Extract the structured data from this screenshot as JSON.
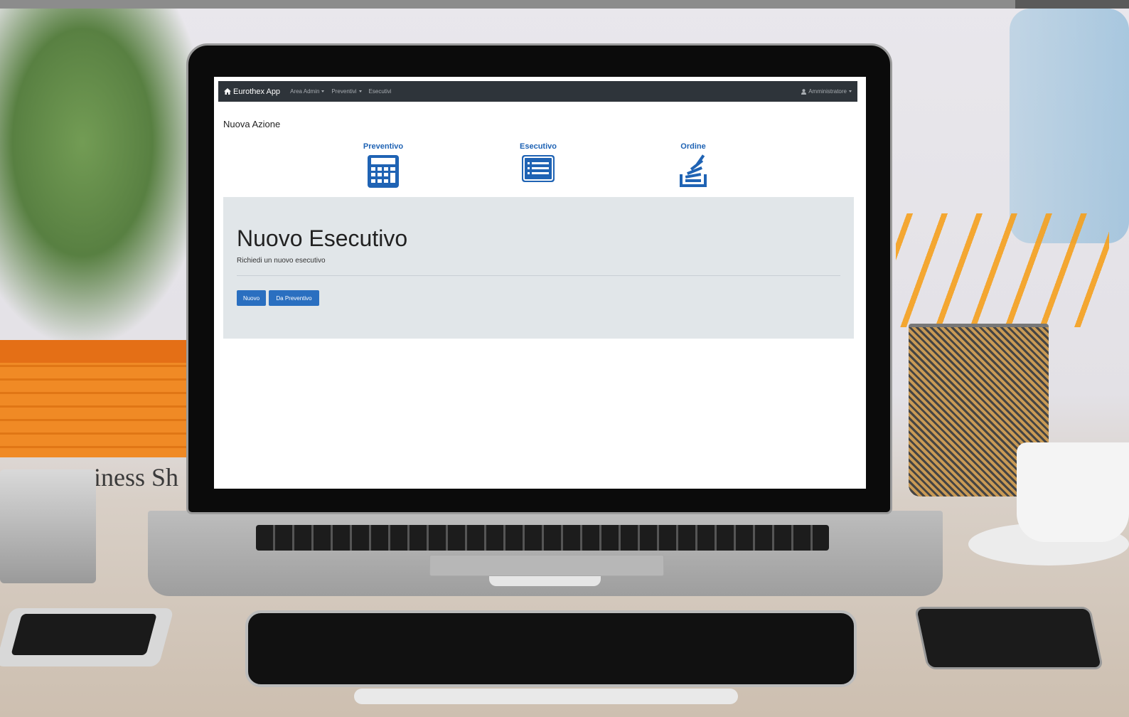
{
  "navbar": {
    "brand": "Eurothex App",
    "home_icon": "home-icon",
    "items": [
      {
        "label": "Area Admin",
        "dropdown": true
      },
      {
        "label": "Preventivi",
        "dropdown": true
      },
      {
        "label": "Esecutivi",
        "dropdown": false
      }
    ],
    "user_menu": {
      "label": "Amministratore",
      "icon": "user-icon"
    }
  },
  "page": {
    "title": "Nuova Azione"
  },
  "actions": [
    {
      "label": "Preventivo",
      "icon": "calculator-icon"
    },
    {
      "label": "Esecutivo",
      "icon": "list-icon"
    },
    {
      "label": "Ordine",
      "icon": "stack-icon"
    }
  ],
  "jumbotron": {
    "title": "Nuovo Esecutivo",
    "subtitle": "Richiedi un nuovo esecutivo",
    "buttons": [
      "Nuovo",
      "Da Preventivo"
    ]
  },
  "background": {
    "book_spine_text": "siness Sh"
  },
  "colors": {
    "navbar": "#2e343a",
    "accent": "#1f63b4",
    "button": "#2a6fc0",
    "jumbotron": "#e1e6e9"
  }
}
